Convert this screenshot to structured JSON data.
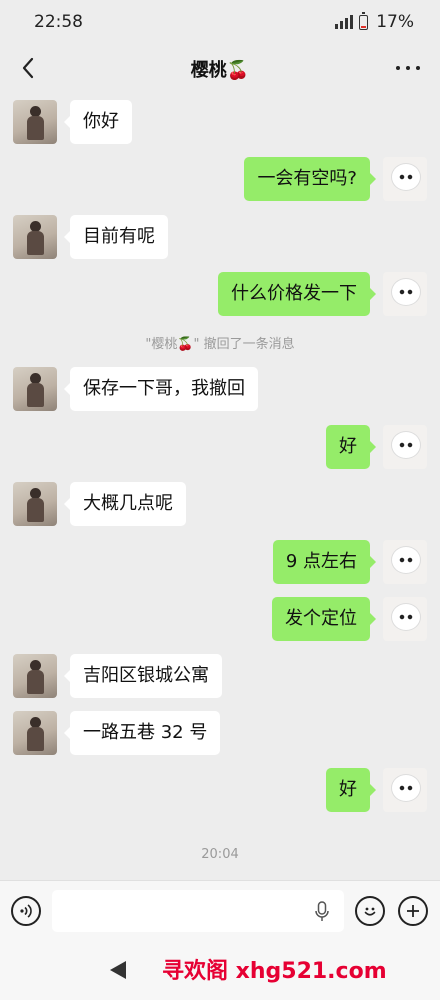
{
  "status": {
    "time": "22:58",
    "battery": "17%"
  },
  "header": {
    "title": "樱桃🍒"
  },
  "messages": [
    {
      "from": "her",
      "text": "你好"
    },
    {
      "from": "me",
      "text": "一会有空吗?"
    },
    {
      "from": "her",
      "text": "目前有呢"
    },
    {
      "from": "me",
      "text": "什么价格发一下"
    },
    {
      "from": "system",
      "text": "\"樱桃🍒\" 撤回了一条消息"
    },
    {
      "from": "her",
      "text": "保存一下哥，我撤回"
    },
    {
      "from": "me",
      "text": "好"
    },
    {
      "from": "her",
      "text": "大概几点呢"
    },
    {
      "from": "me",
      "text": "9 点左右"
    },
    {
      "from": "me",
      "text": "发个定位"
    },
    {
      "from": "her",
      "text": "吉阳区银城公寓"
    },
    {
      "from": "her",
      "text": "一路五巷 32 号"
    },
    {
      "from": "me",
      "text": "好"
    },
    {
      "from": "time",
      "text": "20:04"
    }
  ],
  "input": {
    "value": ""
  },
  "watermark": "寻欢阁 xhg521.com",
  "colors": {
    "incoming_bubble": "#ffffff",
    "outgoing_bubble": "#95ec69",
    "background": "#ededed",
    "watermark": "#e60033"
  },
  "icons": {
    "back": "chevron-left-icon",
    "more": "more-dots-icon",
    "voice": "voice-icon",
    "mic": "mic-icon",
    "emoji": "emoji-icon",
    "plus": "plus-icon",
    "system_back": "system-back-icon"
  }
}
